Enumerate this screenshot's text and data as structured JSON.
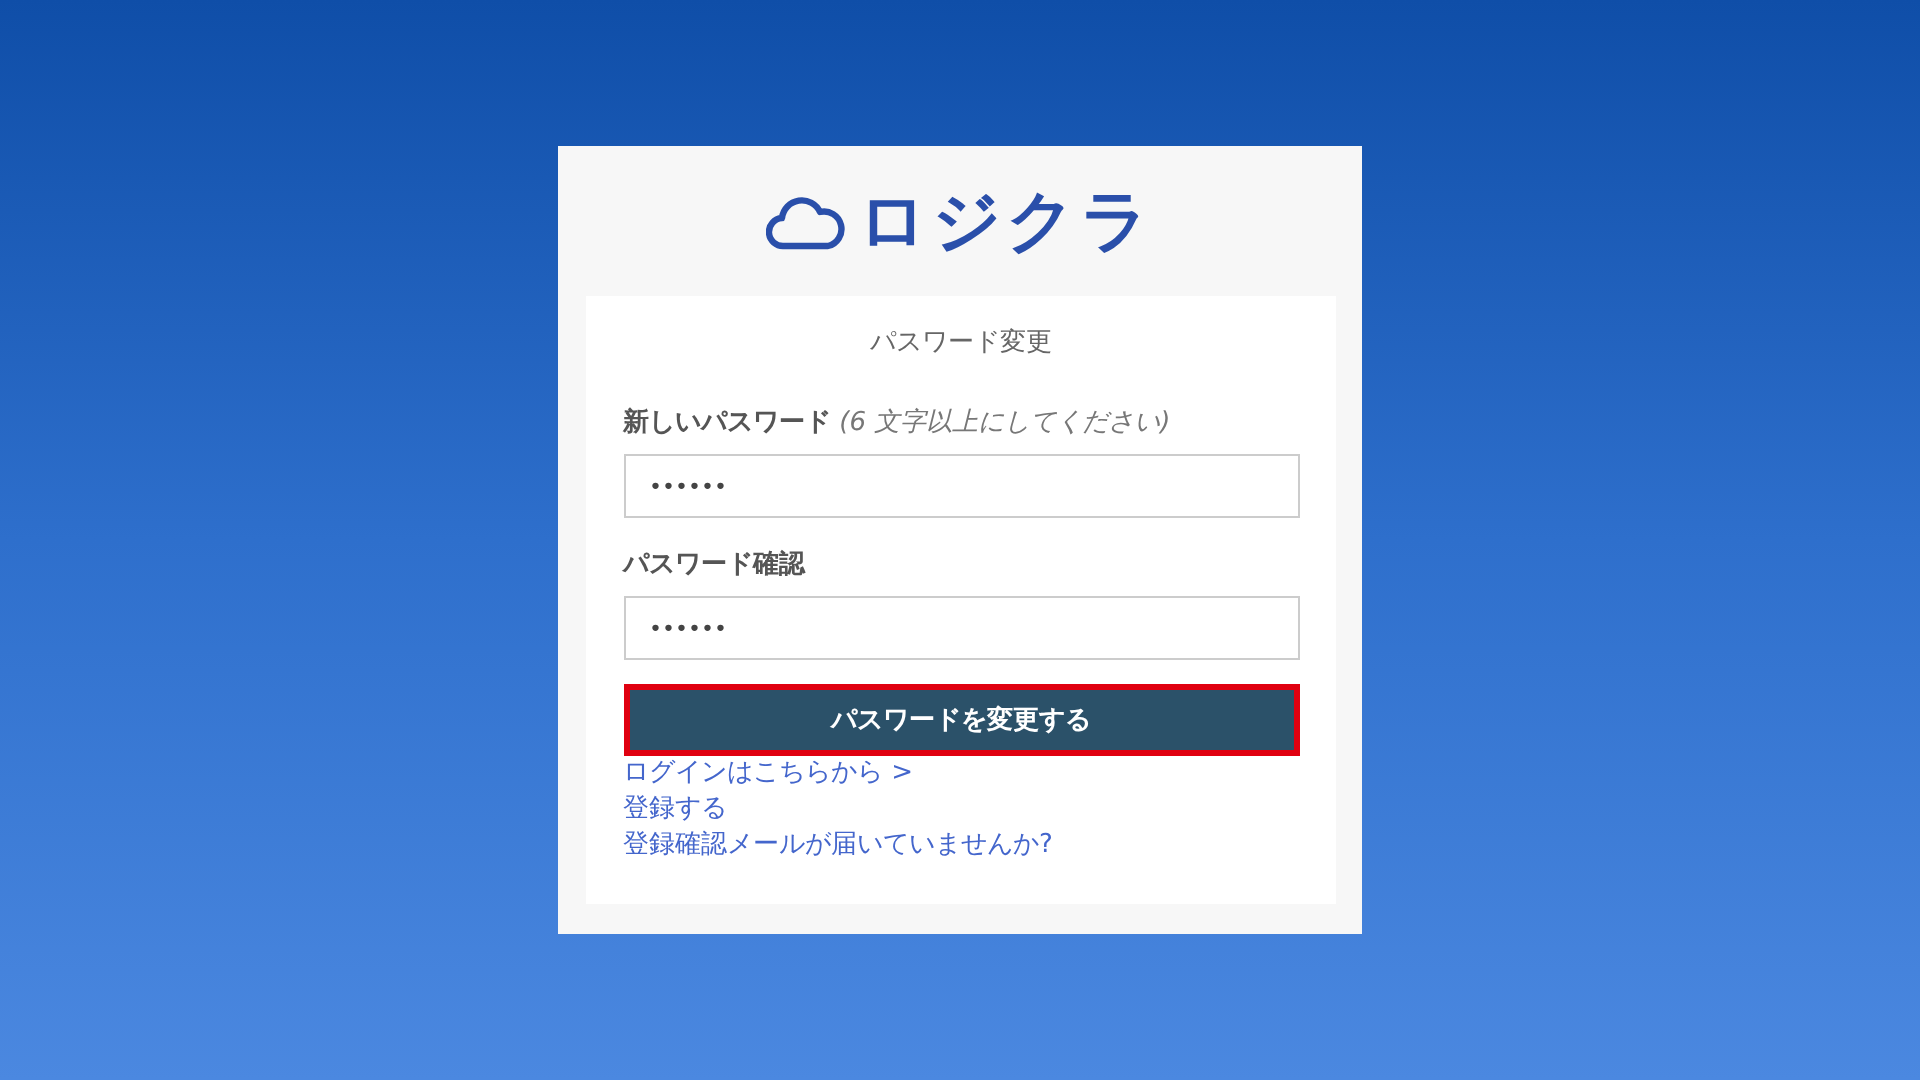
{
  "logo": {
    "text": "ロジクラ"
  },
  "form": {
    "title": "パスワード変更",
    "fields": [
      {
        "label": "新しいパスワード",
        "hint": "(6 文字以上にしてください)",
        "value": "••••••"
      },
      {
        "label": "パスワード確認",
        "value": "••••••"
      }
    ],
    "submit": {
      "label": "パスワードを変更する",
      "highlighted": true
    },
    "links": [
      "ログインはこちらから >",
      "登録する",
      "登録確認メールが届いていませんか?"
    ]
  }
}
